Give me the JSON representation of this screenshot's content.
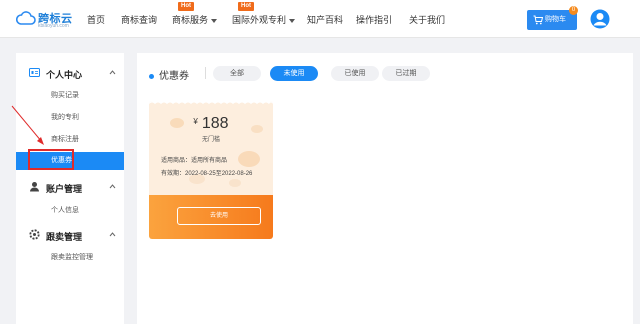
{
  "header": {
    "logo_name": "跨标云",
    "logo_domain": "kbiaoyun.com",
    "nav": [
      {
        "label": "首页"
      },
      {
        "label": "商标查询"
      },
      {
        "label": "商标服务",
        "hot": "Hot"
      },
      {
        "label": "国际外观专利",
        "hot": "Hot"
      },
      {
        "label": "知产百科"
      },
      {
        "label": "操作指引"
      },
      {
        "label": "关于我们"
      }
    ],
    "cart_label": "购物车",
    "cart_count": "0"
  },
  "sidebar": {
    "sections": [
      {
        "title": "个人中心",
        "items": [
          "购买记录",
          "我的专利",
          "商标注册",
          "优惠券"
        ]
      },
      {
        "title": "账户管理",
        "items": [
          "个人信息"
        ]
      },
      {
        "title": "跟卖管理",
        "items": [
          "跟卖监控管理"
        ]
      }
    ]
  },
  "main": {
    "title": "优惠券",
    "tabs": [
      "全部",
      "未使用",
      "已使用",
      "已过期"
    ],
    "active_tab": "未使用",
    "coupon": {
      "currency": "¥",
      "amount": "188",
      "threshold": "无门槛",
      "scope": "适用商品：适用所有商品",
      "validity": "有效期：2022-08-25至2022-08-26",
      "button": "去使用"
    }
  },
  "colors": {
    "accent": "#1b8af5",
    "hot": "#f06b1a",
    "coupon_bg": "#fdeede",
    "coupon_button_from": "#fba33e",
    "coupon_button_to": "#f67a1c",
    "highlight_outline": "#e02b2b"
  }
}
